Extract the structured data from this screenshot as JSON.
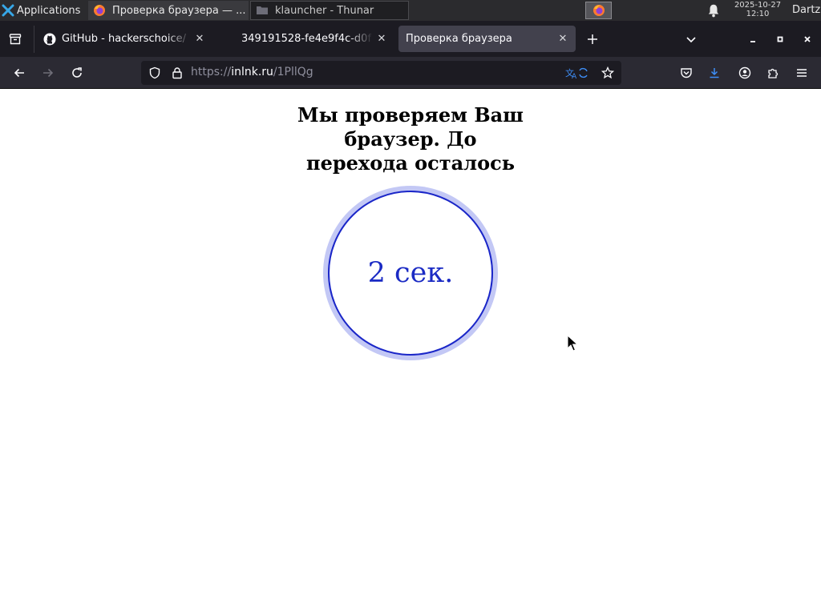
{
  "taskbar": {
    "apps_label": "Applications",
    "tasks": [
      {
        "label": "Проверка браузера — ..."
      },
      {
        "label": "klauncher - Thunar"
      }
    ],
    "clock_date": "2025-10-27",
    "clock_time": "12:10",
    "user": "Dartz"
  },
  "tabs": [
    {
      "label": "GitHub - hackerschoice/"
    },
    {
      "label": "349191528-fe4e9f4c-d0f"
    },
    {
      "label": "Проверка браузера",
      "active": true
    }
  ],
  "url": {
    "scheme": "https://",
    "host": "inlnk.ru",
    "path": "/1PllQg"
  },
  "page": {
    "heading_line1": "Мы проверяем Ваш",
    "heading_line2": "браузер. До",
    "heading_line3": "перехода осталось",
    "countdown": "2 сек."
  },
  "colors": {
    "ring_outer": "#c3c8f5",
    "ring_border": "#1a26c8",
    "countdown_text": "#1b2bc4",
    "tabbar_bg": "#1c1b22",
    "active_tab_bg": "#42414d",
    "navbar_bg": "#2b2a33"
  }
}
